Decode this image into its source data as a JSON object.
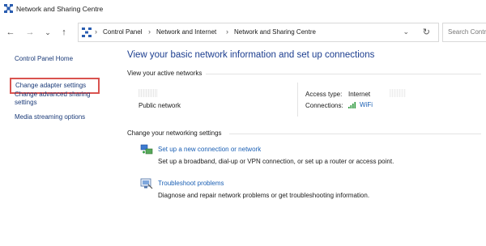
{
  "window": {
    "title": "Network and Sharing Centre"
  },
  "nav": {
    "back": "←",
    "forward": "→",
    "recent": "⌄",
    "up": "↑"
  },
  "address": {
    "crumbs": [
      "Control Panel",
      "Network and Internet",
      "Network and Sharing Centre"
    ],
    "separator": "›",
    "dropdown": "⌄",
    "refresh": "↻"
  },
  "search": {
    "placeholder": "Search Contr"
  },
  "sidebar": {
    "items": [
      {
        "label": "Control Panel Home"
      },
      {
        "label": "Change adapter settings"
      },
      {
        "label": "Change advanced sharing settings"
      },
      {
        "label": "Media streaming options"
      }
    ],
    "highlight_color": "#d9534f"
  },
  "main": {
    "heading": "View your basic network information and set up connections",
    "active_networks": {
      "title": "View your active networks",
      "network_type": "Public network",
      "access_type_label": "Access type:",
      "access_type_value": "Internet",
      "connections_label": "Connections:",
      "connection_name": "WiFi"
    },
    "settings": {
      "title": "Change your networking settings",
      "tasks": [
        {
          "label": "Set up a new connection or network",
          "description": "Set up a broadband, dial-up or VPN connection, or set up a router or access point.",
          "icon": "network-setup-icon"
        },
        {
          "label": "Troubleshoot problems",
          "description": "Diagnose and repair network problems or get troubleshooting information.",
          "icon": "troubleshoot-icon"
        }
      ]
    }
  },
  "colors": {
    "heading": "#1b3d8f",
    "link": "#1a5fb4",
    "sidebar_link": "#1a3a78"
  }
}
